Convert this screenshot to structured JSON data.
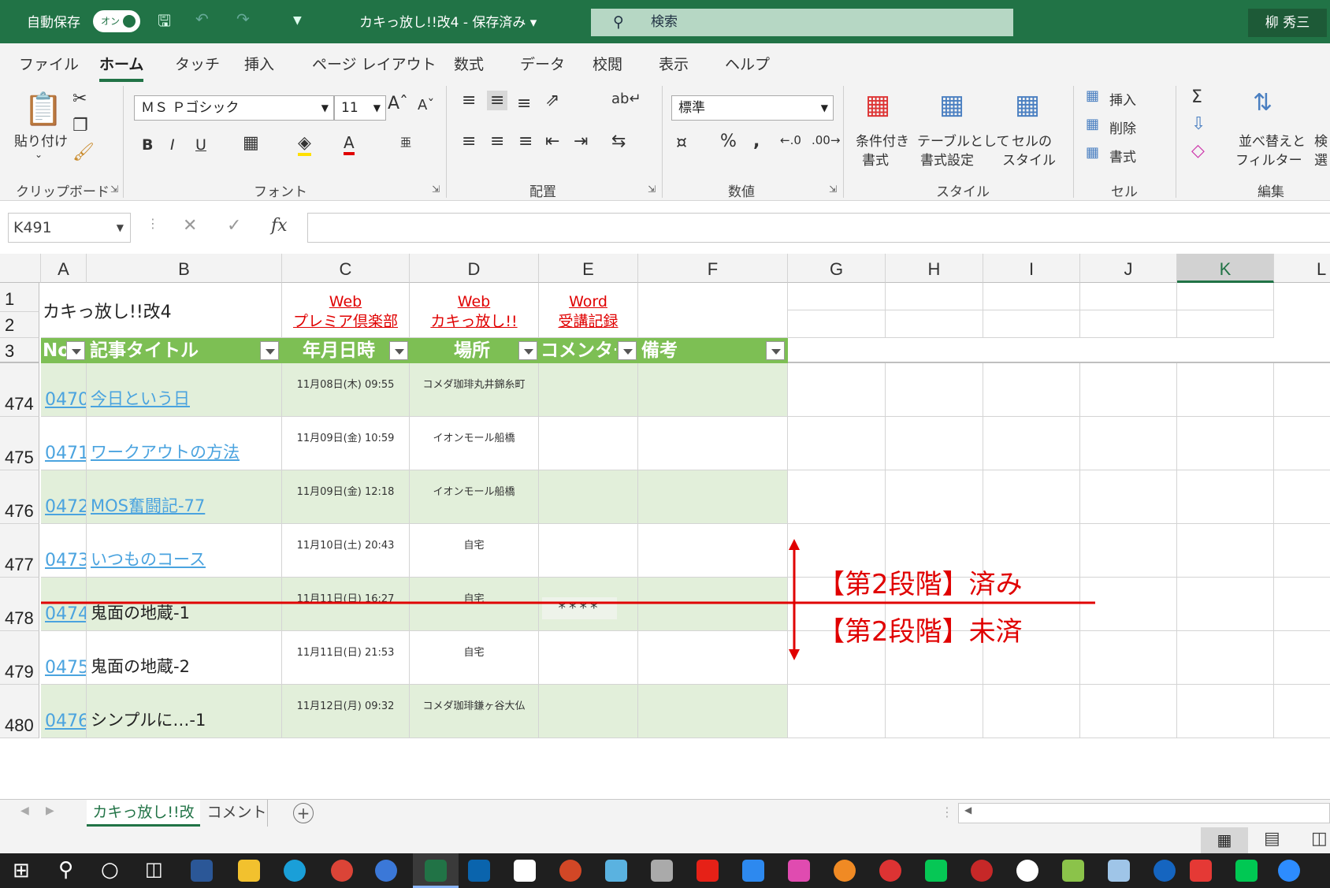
{
  "titlebar": {
    "autosave_label": "自動保存",
    "autosave_state": "オン",
    "filename": "カキっ放し!!改4 - 保存済み",
    "search_placeholder": "検索",
    "user_name": "柳 秀三"
  },
  "menu": {
    "tabs": [
      "ファイル",
      "ホーム",
      "タッチ",
      "挿入",
      "ページ レイアウト",
      "数式",
      "データ",
      "校閲",
      "表示",
      "ヘルプ"
    ]
  },
  "ribbon": {
    "clipboard": {
      "paste": "貼り付け",
      "group": "クリップボード"
    },
    "font": {
      "name": "ＭＳ Ｐゴシック",
      "size": "11",
      "bold": "B",
      "italic": "I",
      "underline": "U",
      "group": "フォント"
    },
    "alignment": {
      "group": "配置"
    },
    "number": {
      "format": "標準",
      "percent": "%",
      "group": "数値"
    },
    "styles": {
      "conditional": "条件付き\n書式",
      "conditional1": "条件付き",
      "conditional2": "書式",
      "table1": "テーブルとして",
      "table2": "書式設定",
      "cell1": "セルの",
      "cell2": "スタイル",
      "group": "スタイル"
    },
    "cells": {
      "insert": "挿入",
      "delete": "削除",
      "format": "書式",
      "group": "セル"
    },
    "editing": {
      "sort1": "並べ替えと",
      "sort2": "フィルター",
      "find1": "検",
      "find2": "選",
      "group": "編集"
    }
  },
  "formula_bar": {
    "name_box": "K491",
    "fx": "fx"
  },
  "columns": [
    "A",
    "B",
    "C",
    "D",
    "E",
    "F",
    "G",
    "H",
    "I",
    "J",
    "K",
    "L"
  ],
  "selected_column": "K",
  "sheet": {
    "title": "カキっ放し!!改4",
    "links": [
      {
        "line1": "Web",
        "line2": "プレミア倶楽部"
      },
      {
        "line1": "Web",
        "line2": "カキっ放し!!"
      },
      {
        "line1": "Word",
        "line2": "受講記録"
      }
    ],
    "headers": [
      "No",
      "記事タイトル",
      "年月日時",
      "場所",
      "コメンター",
      "備考"
    ],
    "rows": [
      {
        "row": "474",
        "no": "0470",
        "title": "今日という日",
        "date": "11月08日(木) 09:55",
        "place": "コメダ珈琲丸井錦糸町",
        "comment": "",
        "title_link": true
      },
      {
        "row": "475",
        "no": "0471",
        "title": "ワークアウトの方法",
        "date": "11月09日(金) 10:59",
        "place": "イオンモール船橋",
        "comment": "",
        "title_link": true
      },
      {
        "row": "476",
        "no": "0472",
        "title": "MOS奮闘記-77",
        "date": "11月09日(金) 12:18",
        "place": "イオンモール船橋",
        "comment": "",
        "title_link": true
      },
      {
        "row": "477",
        "no": "0473",
        "title": "いつものコース",
        "date": "11月10日(土) 20:43",
        "place": "自宅",
        "comment": "",
        "title_link": true
      },
      {
        "row": "478",
        "no": "0474",
        "title": "鬼面の地蔵-1",
        "date": "11月11日(日) 16:27",
        "place": "自宅",
        "comment": "****",
        "title_link": false
      },
      {
        "row": "479",
        "no": "0475",
        "title": "鬼面の地蔵-2",
        "date": "11月11日(日) 21:53",
        "place": "自宅",
        "comment": "",
        "title_link": false
      },
      {
        "row": "480",
        "no": "0476",
        "title": "シンプルに…-1",
        "date": "11月12日(月) 09:32",
        "place": "コメダ珈琲鎌ヶ谷大仏",
        "comment": "",
        "title_link": false
      }
    ]
  },
  "annotation": {
    "done": "【第2段階】済み",
    "not_done": "【第2段階】未済"
  },
  "sheet_tabs": [
    "カキっ放し!!改",
    "コメント"
  ],
  "colors": {
    "excel_green": "#217346",
    "header_green": "#7dbf54",
    "band_green": "#e2efda",
    "link_blue": "#4aa3df",
    "annotation_red": "#e00000"
  }
}
